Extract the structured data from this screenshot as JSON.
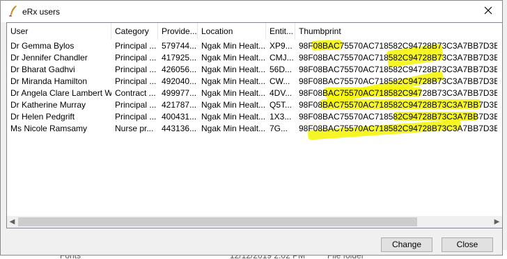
{
  "window": {
    "title": "eRx users"
  },
  "columns": [
    "User",
    "Category",
    "Provide...",
    "Location",
    "Entit...",
    "Thumbprint"
  ],
  "rows": [
    [
      "Dr Gemma Bylos",
      "Principal ...",
      "579744...",
      "Ngak Min Healt...",
      "XP9...",
      "98F08BAC75570AC718582C94728B73C3A7BB7D3E"
    ],
    [
      "Dr Jennifer Chandler",
      "Principal ...",
      "417925...",
      "Ngak Min Healt...",
      "CMJ...",
      "98F08BAC75570AC718582C94728B73C3A7BB7D3E"
    ],
    [
      "Dr Bharat Gadhvi",
      "Principal ...",
      "426056...",
      "Ngak Min Healt...",
      "56D...",
      "98F08BAC75570AC718582C94728B73C3A7BB7D3E"
    ],
    [
      "Dr Miranda Hamilton",
      "Principal ...",
      "492040...",
      "Ngak Min Healt...",
      "CW...",
      "98F08BAC75570AC718582C94728B73C3A7BB7D3E"
    ],
    [
      "Dr Angela Clare Lambert Wil...",
      "Contract ...",
      "499977...",
      "Ngak Min Healt...",
      "4DV...",
      "98F08BAC75570AC718582C94728B73C3A7BB7D3E"
    ],
    [
      "Dr Katherine Murray",
      "Principal ...",
      "421787...",
      "Ngak Min Healt...",
      "Q5T...",
      "98F08BAC75570AC718582C94728B73C3A7BB7D3E"
    ],
    [
      "Dr Helen Pedgrift",
      "Principal ...",
      "400431...",
      "Ngak Min Healt...",
      "1X3...",
      "98F08BAC75570AC718582C94728B73C3A7BB7D3E"
    ],
    [
      "Ms Nicole Ramsamy",
      "Nurse pr...",
      "443136...",
      "Ngak Min Healt...",
      "7G...",
      "98F08BAC75570AC718582C94728B73C3A7BB7D3E"
    ]
  ],
  "buttons": {
    "change": "Change",
    "close": "Close"
  },
  "background": {
    "fragment_left": "Fonts",
    "fragment_date": "12/12/2019 2:02 PM",
    "fragment_type": "File folder"
  },
  "colors": {
    "highlight": "#f5f500",
    "scroll_accent": "#1e6fc4"
  }
}
